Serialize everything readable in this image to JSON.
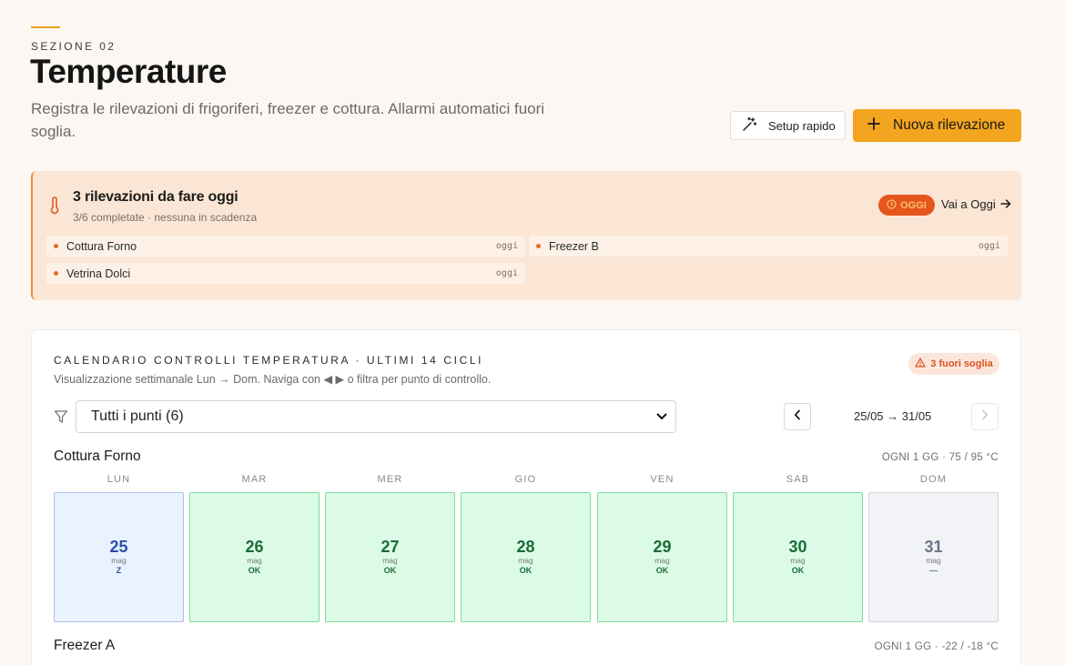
{
  "header": {
    "eyebrow": "SEZIONE 02",
    "title": "Temperature",
    "subtitle": "Registra le rilevazioni di frigoriferi, freezer e cottura. Allarmi automatici fuori soglia.",
    "setup_label": "Setup rapido",
    "new_label": "Nuova rilevazione"
  },
  "alert": {
    "title": "3 rilevazioni da fare oggi",
    "subtitle": "3/6 completate · nessuna in scadenza",
    "badge": "OGGI",
    "link": "Vai a Oggi",
    "items": [
      {
        "label": "Cottura Forno",
        "due": "oggi"
      },
      {
        "label": "Freezer B",
        "due": "oggi"
      },
      {
        "label": "Vetrina Dolci",
        "due": "oggi"
      }
    ]
  },
  "calendar": {
    "title": "CALENDARIO CONTROLLI TEMPERATURA · ULTIMI 14 CICLI",
    "subtitle": "Visualizzazione settimanale Lun → Dom. Naviga con ◀ ▶ o filtra per punto di controllo.",
    "out_badge": "3 fuori soglia",
    "filter_value": "Tutti i punti (6)",
    "week_range": "25/05 → 31/05",
    "days": [
      "LUN",
      "MAR",
      "MER",
      "GIO",
      "VEN",
      "SAB",
      "DOM"
    ],
    "sections": [
      {
        "name": "Cottura Forno",
        "meta": "OGNI 1 GG · 75 / 95 °C",
        "cells": [
          {
            "num": "25",
            "mon": "mag",
            "status": "Z",
            "kind": "todo"
          },
          {
            "num": "26",
            "mon": "mag",
            "status": "OK",
            "kind": "ok"
          },
          {
            "num": "27",
            "mon": "mag",
            "status": "OK",
            "kind": "ok"
          },
          {
            "num": "28",
            "mon": "mag",
            "status": "OK",
            "kind": "ok"
          },
          {
            "num": "29",
            "mon": "mag",
            "status": "OK",
            "kind": "ok"
          },
          {
            "num": "30",
            "mon": "mag",
            "status": "OK",
            "kind": "ok"
          },
          {
            "num": "31",
            "mon": "mag",
            "status": "—",
            "kind": "future"
          }
        ]
      },
      {
        "name": "Freezer A",
        "meta": "OGNI 1 GG · -22 / -18 °C"
      }
    ]
  },
  "colors": {
    "accent": "#f3a51f",
    "alert_bg": "#fbe6d5",
    "ok_bg": "#dcfbe6",
    "todo_bg": "#eaf2ff",
    "danger": "#e6561c"
  },
  "icons": [
    "magic-wand-icon",
    "plus-icon",
    "thermometer-icon",
    "clock-icon",
    "arrow-right-icon",
    "warning-icon",
    "filter-icon",
    "chevron-down-icon",
    "chevron-left-icon",
    "chevron-right-icon"
  ]
}
